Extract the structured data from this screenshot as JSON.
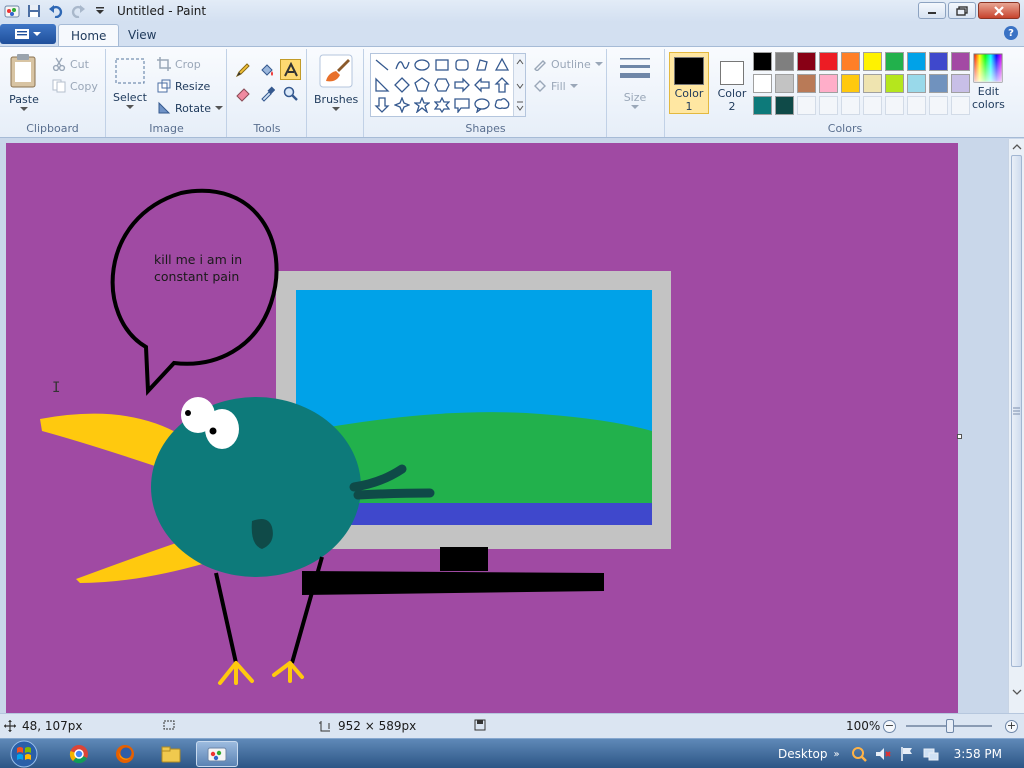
{
  "window": {
    "title": "Untitled - Paint"
  },
  "tabs": [
    {
      "label": "Home"
    },
    {
      "label": "View"
    }
  ],
  "clipboard": {
    "paste": "Paste",
    "cut": "Cut",
    "copy": "Copy",
    "label": "Clipboard"
  },
  "image": {
    "select": "Select",
    "crop": "Crop",
    "resize": "Resize",
    "rotate": "Rotate",
    "label": "Image"
  },
  "tools": {
    "label": "Tools"
  },
  "brushes": {
    "label": "Brushes"
  },
  "shapes": {
    "outline": "Outline",
    "fill": "Fill",
    "label": "Shapes"
  },
  "size": {
    "label": "Size"
  },
  "colors": {
    "color1_line1": "Color",
    "color1_line2": "1",
    "color2_line1": "Color",
    "color2_line2": "2",
    "edit_line1": "Edit",
    "edit_line2": "colors",
    "label": "Colors",
    "color1_value": "#000000",
    "color2_value": "#ffffff",
    "palette_row1": [
      "#000000",
      "#7f7f7f",
      "#880015",
      "#ed1c24",
      "#ff7f27",
      "#fff200",
      "#22b14c",
      "#00a2e8",
      "#3f48cc",
      "#a349a4"
    ],
    "palette_row2": [
      "#ffffff",
      "#c3c3c3",
      "#b97a57",
      "#ffaec9",
      "#ffc90e",
      "#efe4b0",
      "#b5e61d",
      "#99d9ea",
      "#7092be",
      "#c8bfe7"
    ],
    "palette_row3": [
      "#0d7a7a",
      "#0f4a48"
    ]
  },
  "canvas": {
    "background": "#a04aa3",
    "speech_line1": "kill me i am in",
    "speech_line2": "constant pain"
  },
  "status": {
    "cursor_pos": "48, 107px",
    "canvas_size": "952 × 589px",
    "zoom": "100%"
  },
  "taskbar": {
    "desktop": "Desktop",
    "time": "3:58 PM"
  }
}
